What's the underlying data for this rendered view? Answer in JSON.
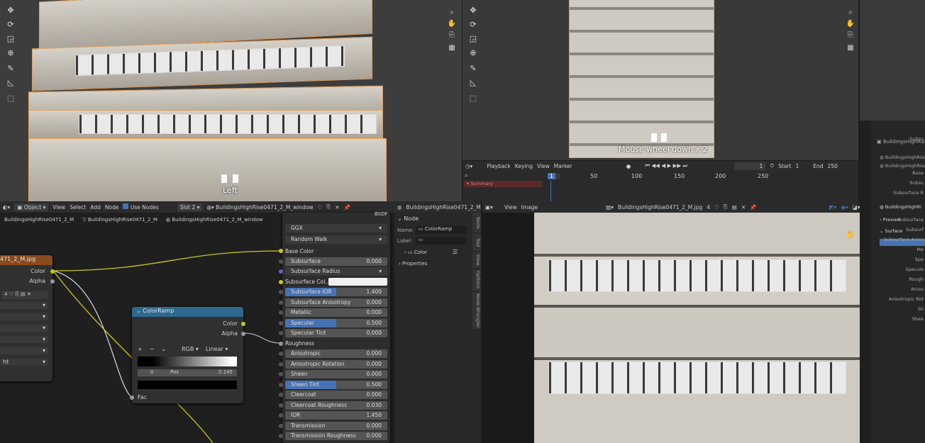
{
  "viewport_left": {
    "overlay_label": "Left"
  },
  "viewport_right": {
    "overlay_label": "Mouse wheel down x 2"
  },
  "timeline": {
    "menus": [
      "Playback",
      "Keying",
      "View",
      "Marker"
    ],
    "current_frame": "1",
    "start_label": "Start",
    "start_value": "1",
    "end_label": "End",
    "end_value": "250",
    "ticks": [
      "1",
      "50",
      "100",
      "150",
      "200",
      "250"
    ],
    "summary": "Summary"
  },
  "node_header": {
    "mode": "Object",
    "menus": [
      "View",
      "Select",
      "Add",
      "Node"
    ],
    "use_nodes": "Use Nodes",
    "slot": "Slot 2",
    "material": "BuildingsHighRise0471_2_M_window"
  },
  "breadcrumb": [
    "BuildingsHighRise0471_2_M",
    "BuildingsHighRise0471_2_M",
    "BuildingsHighRise0471_2_M_window"
  ],
  "image_node": {
    "title": "471_2_M.jpg",
    "out_color": "Color",
    "out_alpha": "Alpha",
    "user_count": "4",
    "last_option": "ht"
  },
  "colorramp": {
    "title": "ColorRamp",
    "out_color": "Color",
    "out_alpha": "Alpha",
    "mode": "RGB",
    "interp": "Linear",
    "index": "0",
    "pos_label": "Pos",
    "pos_value": "0.145",
    "fac": "Fac"
  },
  "bsdf": {
    "title": "BSDF",
    "distribution": "GGX",
    "subsurface_method": "Random Walk",
    "base_color": "Base Color",
    "subsurface_color": "Subsurface Col...",
    "roughness": "Roughness",
    "rows_a": [
      {
        "label": "Subsurface",
        "value": "0.000",
        "sel": false
      }
    ],
    "subsurface_radius": "Subsurface Radius",
    "rows_b": [
      {
        "label": "Subsurface IOR",
        "value": "1.400",
        "sel": true
      },
      {
        "label": "Subsurface Anisotropy",
        "value": "0.000",
        "sel": false
      },
      {
        "label": "Metallic",
        "value": "0.000",
        "sel": false
      },
      {
        "label": "Specular",
        "value": "0.500",
        "sel": true
      },
      {
        "label": "Specular Tint",
        "value": "0.000",
        "sel": false
      }
    ],
    "rows_c": [
      {
        "label": "Anisotropic",
        "value": "0.000",
        "sel": false
      },
      {
        "label": "Anisotropic Rotation",
        "value": "0.000",
        "sel": false
      },
      {
        "label": "Sheen",
        "value": "0.000",
        "sel": false
      },
      {
        "label": "Sheen Tint",
        "value": "0.500",
        "sel": true
      },
      {
        "label": "Clearcoat",
        "value": "0.000",
        "sel": false
      },
      {
        "label": "Clearcoat Roughness",
        "value": "0.030",
        "sel": false
      },
      {
        "label": "IOR",
        "value": "1.450",
        "sel": false
      },
      {
        "label": "Transmission",
        "value": "0.000",
        "sel": false
      },
      {
        "label": "Transmission Roughness",
        "value": "0.000",
        "sel": false
      }
    ]
  },
  "sidebar": {
    "section": "Node",
    "name_label": "Name:",
    "name_value": "ColorRamp",
    "label_label": "Label:",
    "color": "Color",
    "properties": "Properties",
    "tabs": [
      "Node",
      "Tool",
      "View",
      "Options",
      "Node Wrangler"
    ]
  },
  "image_editor": {
    "menus": [
      "View",
      "Image"
    ],
    "image_name": "BuildingsHighRise0471_2_M.jpg",
    "users": "4"
  },
  "right_panel": {
    "outliner": [
      "BuildingsHighRise",
      "BuildingsHighRise",
      "BuildingsHighRise"
    ],
    "material_name": "BuildingsHighRi",
    "preview": "Preview",
    "surface": "Surface",
    "labels": [
      "Subsu",
      "Base",
      "Subsu",
      "Subsurface R",
      "Subsurface",
      "Subsurf",
      "Subsurface Aniso",
      "Me",
      "Spe",
      "Specula",
      "Rough",
      "Aniso",
      "Anisotropic Rot",
      "Sh",
      "Shee"
    ]
  },
  "colors": {
    "accent": "#4772b3",
    "ramp_header": "#2e6a8f",
    "image_header": "#8a4a1e",
    "link_yellow": "#c8c81e"
  }
}
